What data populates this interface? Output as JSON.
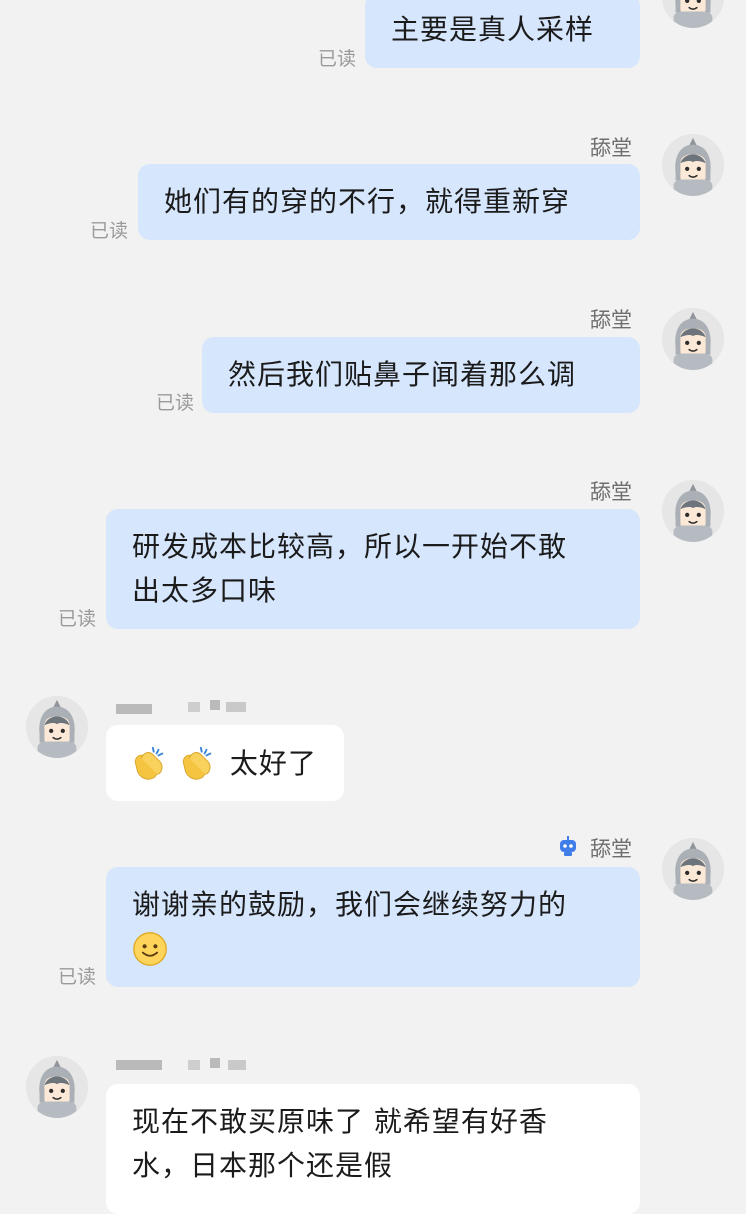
{
  "read_label": "已读",
  "sender_name": "舔堂",
  "messages": [
    {
      "text": "主要是真人采样"
    },
    {
      "text": "她们有的穿的不行，就得重新穿"
    },
    {
      "text": "然后我们贴鼻子闻着那么调"
    },
    {
      "line1": "研发成本比较高，所以一开始不敢",
      "line2": "出太多口味"
    },
    {
      "text": "太好了",
      "emoji": [
        "clapping-hands",
        "clapping-hands"
      ]
    },
    {
      "line1": "谢谢亲的鼓励，我们会继续努力的",
      "emoji": "slightly-smiling-face"
    },
    {
      "line1": "现在不敢买原味了 就希望有好香",
      "line2": "水，日本那个还是假"
    }
  ],
  "icons": {
    "avatar": "knight-helmet-avatar",
    "robot": "robot-icon"
  },
  "colors": {
    "background": "#f2f2f2",
    "outgoing_bubble": "#d6e6fd",
    "incoming_bubble": "#ffffff",
    "robot_icon": "#3f7ee8"
  }
}
